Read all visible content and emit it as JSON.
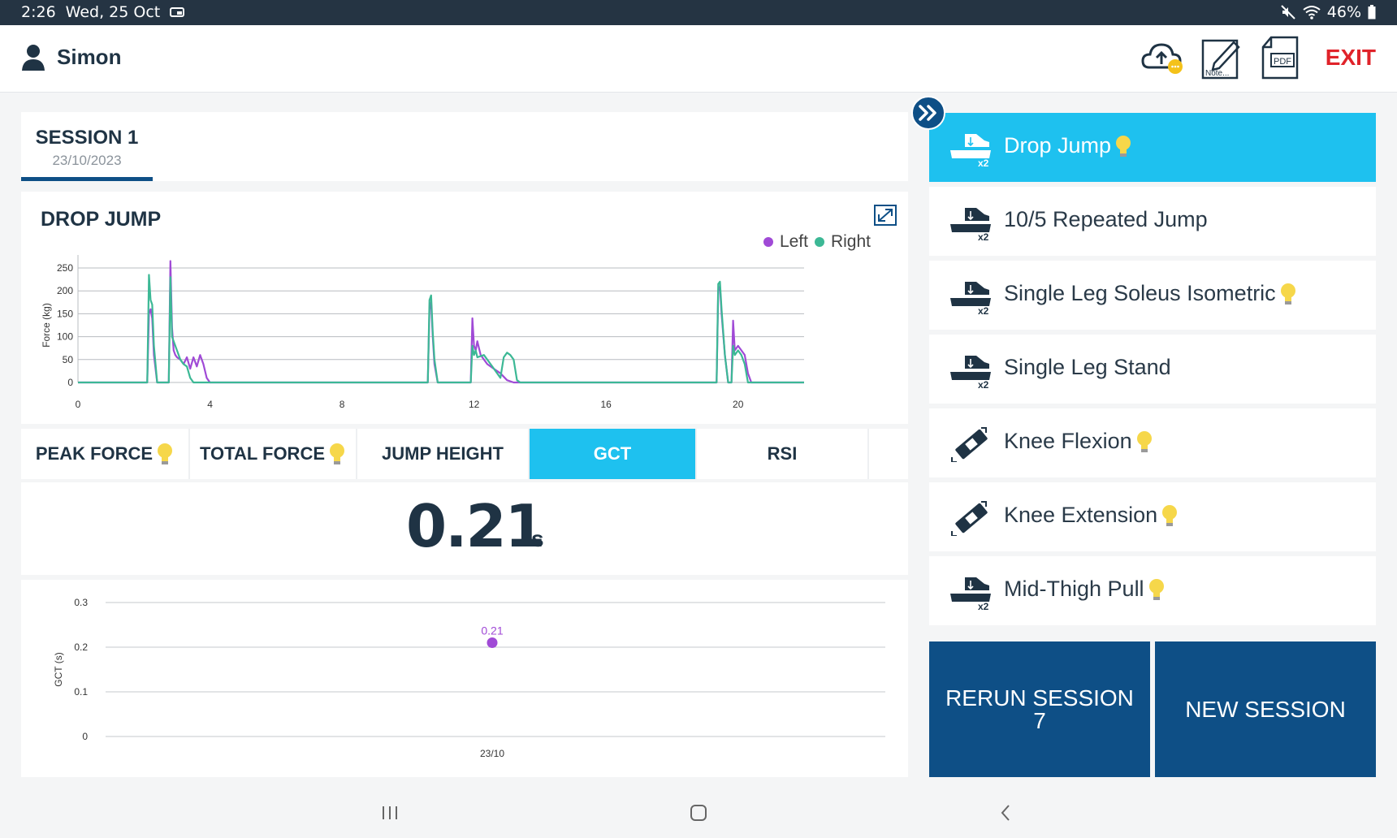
{
  "status_bar": {
    "time": "2:26",
    "date": "Wed, 25 Oct",
    "battery": "46%"
  },
  "header": {
    "user_name": "Simon",
    "exit_label": "EXIT",
    "notes_label": "Note...",
    "pdf_label": "PDF"
  },
  "session": {
    "title": "SESSION 1",
    "date": "23/10/2023"
  },
  "force_chart": {
    "title": "DROP JUMP",
    "legend": [
      {
        "name": "Left",
        "color": "#a04ad6"
      },
      {
        "name": "Right",
        "color": "#3cb895"
      }
    ]
  },
  "metric_tabs": [
    {
      "label": "PEAK FORCE",
      "bulb": true
    },
    {
      "label": "TOTAL FORCE",
      "bulb": true
    },
    {
      "label": "JUMP HEIGHT",
      "bulb": false
    },
    {
      "label": "GCT",
      "bulb": false,
      "active": true
    },
    {
      "label": "RSI",
      "bulb": false
    }
  ],
  "metric_value": {
    "value": "0.21",
    "unit": "s"
  },
  "chart_data": [
    {
      "type": "line",
      "title": "DROP JUMP",
      "xlabel": "",
      "ylabel": "Force (kg)",
      "xlim": [
        0,
        22
      ],
      "ylim": [
        0,
        250
      ],
      "xticks": [
        0,
        4,
        8,
        12,
        16,
        20
      ],
      "yticks": [
        0,
        50,
        100,
        150,
        200,
        250
      ],
      "grid": true,
      "legend_position": "top-right",
      "series": [
        {
          "name": "Left",
          "color": "#a04ad6",
          "x": [
            0,
            2.1,
            2.15,
            2.2,
            2.25,
            2.3,
            2.4,
            2.45,
            2.75,
            2.8,
            2.85,
            2.9,
            2.95,
            3.0,
            3.1,
            3.2,
            3.3,
            3.4,
            3.5,
            3.6,
            3.7,
            3.8,
            3.9,
            4.0,
            10.6,
            10.65,
            10.7,
            10.75,
            10.8,
            10.9,
            11.0,
            11.9,
            11.95,
            12.0,
            12.05,
            12.1,
            12.2,
            12.4,
            12.6,
            12.8,
            13.0,
            13.2,
            13.4,
            13.5,
            19.35,
            19.4,
            19.45,
            19.5,
            19.6,
            19.7,
            19.8,
            19.85,
            19.9,
            20.0,
            20.1,
            20.2,
            20.3,
            20.4,
            22
          ],
          "y": [
            0,
            0,
            150,
            160,
            140,
            60,
            0,
            0,
            0,
            265,
            120,
            70,
            60,
            55,
            50,
            40,
            55,
            30,
            55,
            35,
            60,
            40,
            10,
            0,
            0,
            160,
            175,
            100,
            40,
            0,
            0,
            0,
            140,
            80,
            70,
            90,
            60,
            40,
            30,
            20,
            5,
            0,
            0,
            0,
            0,
            200,
            210,
            150,
            60,
            0,
            0,
            135,
            70,
            80,
            70,
            60,
            20,
            0,
            0
          ]
        },
        {
          "name": "Right",
          "color": "#3cb895",
          "x": [
            0,
            2.1,
            2.15,
            2.2,
            2.25,
            2.3,
            2.4,
            2.45,
            2.75,
            2.8,
            2.85,
            2.9,
            3.0,
            3.1,
            3.2,
            3.3,
            3.4,
            3.5,
            3.6,
            10.6,
            10.65,
            10.7,
            10.75,
            10.8,
            10.9,
            11.0,
            11.9,
            11.95,
            12.0,
            12.05,
            12.1,
            12.3,
            12.5,
            12.7,
            12.8,
            12.9,
            13.0,
            13.1,
            13.2,
            13.3,
            13.4,
            19.35,
            19.4,
            19.45,
            19.5,
            19.6,
            19.7,
            19.8,
            19.85,
            19.9,
            20.0,
            20.1,
            20.2,
            20.3,
            22
          ],
          "y": [
            0,
            0,
            235,
            180,
            170,
            80,
            0,
            0,
            0,
            230,
            100,
            90,
            70,
            50,
            40,
            35,
            10,
            0,
            0,
            0,
            180,
            190,
            110,
            50,
            0,
            0,
            0,
            80,
            60,
            70,
            55,
            60,
            40,
            20,
            10,
            55,
            65,
            60,
            50,
            5,
            0,
            0,
            215,
            220,
            160,
            60,
            0,
            0,
            80,
            60,
            70,
            60,
            40,
            0,
            0
          ]
        }
      ]
    },
    {
      "type": "scatter",
      "title": "",
      "xlabel": "",
      "ylabel": "GCT (s)",
      "categories": [
        "23/10"
      ],
      "ylim": [
        0,
        0.3
      ],
      "yticks": [
        0,
        0.1,
        0.2,
        0.3
      ],
      "grid": true,
      "series": [
        {
          "values": [
            0.21
          ],
          "labels": [
            "0.21"
          ],
          "color": "#a04ad6"
        }
      ]
    }
  ],
  "tests": [
    {
      "label": "Drop Jump",
      "icon": "force-plate-icon",
      "bulb": true,
      "active": true
    },
    {
      "label": "10/5 Repeated Jump",
      "icon": "force-plate-icon",
      "bulb": false
    },
    {
      "label": "Single Leg Soleus Isometric",
      "icon": "force-plate-icon",
      "bulb": true
    },
    {
      "label": "Single Leg Stand",
      "icon": "force-plate-icon",
      "bulb": false
    },
    {
      "label": "Knee Flexion",
      "icon": "dynamometer-icon",
      "bulb": true
    },
    {
      "label": "Knee Extension",
      "icon": "dynamometer-icon",
      "bulb": true
    },
    {
      "label": "Mid-Thigh Pull",
      "icon": "force-plate-icon",
      "bulb": true
    }
  ],
  "icon_badge": "x2",
  "buttons": {
    "rerun": "RERUN SESSION 7",
    "new": "NEW SESSION"
  },
  "colors": {
    "accent": "#1ec1ef",
    "primary": "#0e4f86",
    "exit": "#e0232a"
  }
}
